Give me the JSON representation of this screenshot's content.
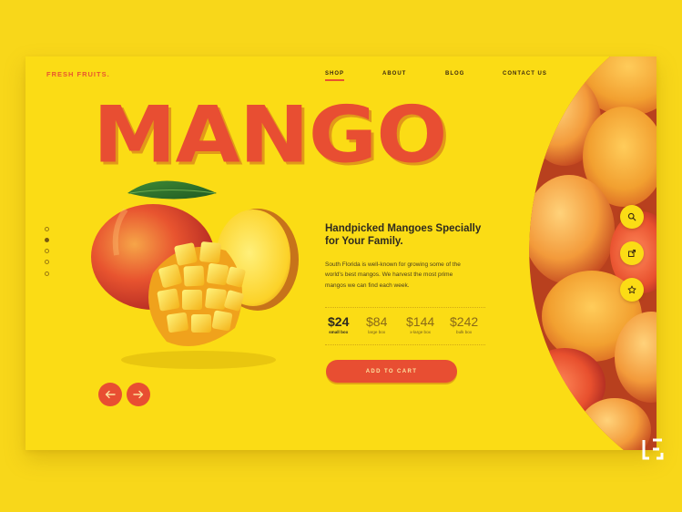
{
  "header": {
    "brand": "FRESH FRUITS.",
    "nav": [
      {
        "label": "SHOP",
        "active": true
      },
      {
        "label": "ABOUT",
        "active": false
      },
      {
        "label": "BLOG",
        "active": false
      },
      {
        "label": "CONTACT US",
        "active": false
      }
    ]
  },
  "hero": {
    "title": "MANGO",
    "headline_line1": "Handpicked Mangoes Specially",
    "headline_line2": "for Your Family.",
    "description": "South Florida is well-known for growing some of the world's best mangos.  We harvest the most prime mangos we can find each week."
  },
  "prices": [
    {
      "value": "$24",
      "label": "small box",
      "selected": true
    },
    {
      "value": "$84",
      "label": "large box",
      "selected": false
    },
    {
      "value": "$144",
      "label": "x-large box",
      "selected": false
    },
    {
      "value": "$242",
      "label": "bulk box",
      "selected": false
    }
  ],
  "cart_button": "ADD TO CART",
  "slider": {
    "count": 5,
    "active_index": 1
  },
  "controls": {
    "prev_icon": "arrow-left-icon",
    "next_icon": "arrow-right-icon",
    "side_icons": [
      "search-icon",
      "share-icon",
      "star-icon"
    ]
  },
  "colors": {
    "background": "#f8d71a",
    "accent": "#e84e32",
    "text_dark": "#2e2a20"
  }
}
